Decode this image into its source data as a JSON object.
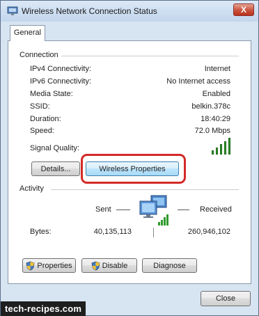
{
  "window": {
    "title": "Wireless Network Connection Status",
    "close_glyph": "X"
  },
  "tabs": [
    {
      "label": "General"
    }
  ],
  "connection": {
    "heading": "Connection",
    "rows": [
      {
        "label": "IPv4 Connectivity:",
        "value": "Internet"
      },
      {
        "label": "IPv6 Connectivity:",
        "value": "No Internet access"
      },
      {
        "label": "Media State:",
        "value": "Enabled"
      },
      {
        "label": "SSID:",
        "value": "belkin.378c"
      },
      {
        "label": "Duration:",
        "value": "18:40:29"
      },
      {
        "label": "Speed:",
        "value": "72.0 Mbps"
      }
    ],
    "signal_label": "Signal Quality:",
    "signal_bars": 5,
    "details_button": "Details...",
    "wireless_properties_button": "Wireless Properties"
  },
  "activity": {
    "heading": "Activity",
    "sent_label": "Sent",
    "received_label": "Received",
    "bytes_label": "Bytes:",
    "bytes_sent": "40,135,113",
    "bytes_received": "260,946,102"
  },
  "actions": {
    "properties_button": "Properties",
    "disable_button": "Disable",
    "diagnose_button": "Diagnose"
  },
  "footer": {
    "close_button": "Close"
  },
  "watermark": "tech-recipes.com",
  "colors": {
    "highlight": "#d32a27",
    "signal": "#2f9a2b",
    "focus_button": "#bee6fd"
  },
  "icons": [
    "network-status-icon",
    "close-icon",
    "signal-strength-icon",
    "network-computer-icon",
    "shield-icon"
  ]
}
